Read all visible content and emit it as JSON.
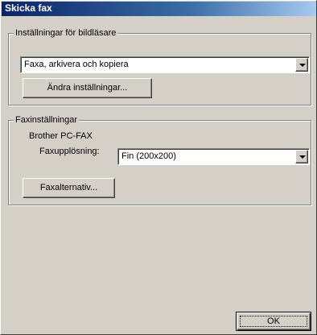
{
  "window": {
    "title": "Skicka fax"
  },
  "scanner_settings": {
    "group_label": "Inställningar för bildläsare",
    "mode_value": "Faxa, arkivera och kopiera",
    "change_settings_label": "Ändra inställningar..."
  },
  "fax_settings": {
    "group_label": "Faxinställningar",
    "driver_name": "Brother PC-FAX",
    "resolution_label": "Faxupplösning:",
    "resolution_value": "Fin (200x200)",
    "fax_options_label": "Faxalternativ..."
  },
  "footer": {
    "ok_label": "OK"
  },
  "colors": {
    "face": "#d4d0c8",
    "titlebar_start": "#0a246a",
    "titlebar_end": "#a6caf0"
  }
}
